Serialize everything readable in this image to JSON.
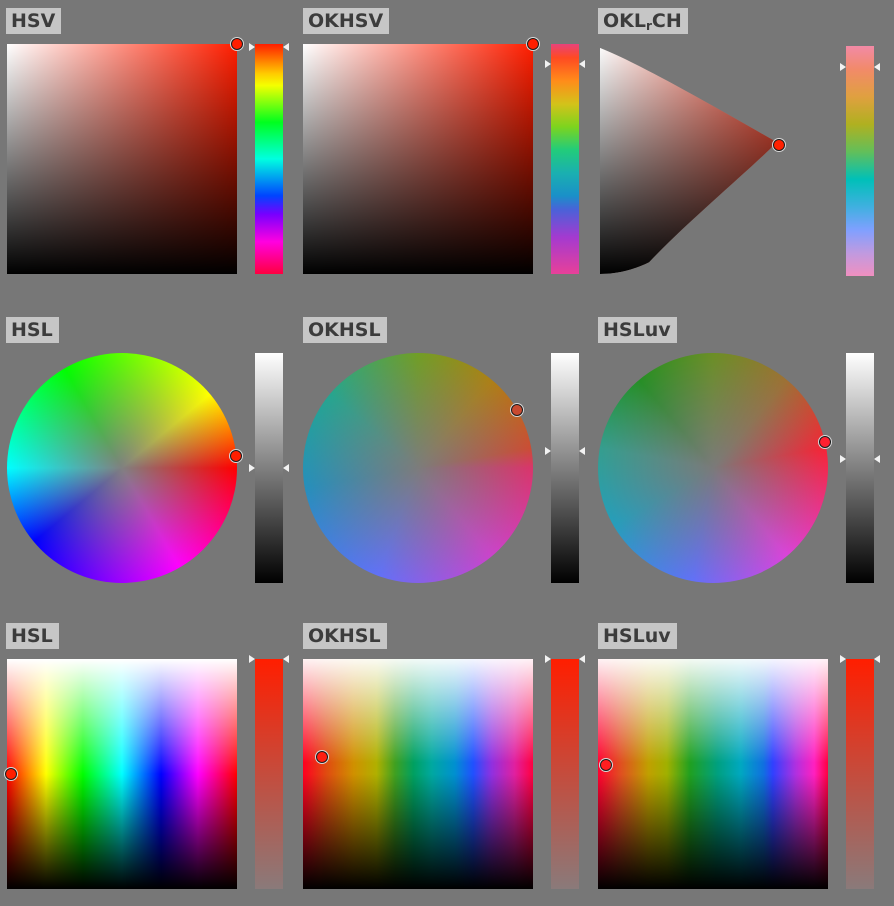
{
  "pickers": {
    "hsv": "HSV",
    "okhsv": "OKHSV",
    "oklrch_base": "OKL",
    "oklrch_sub": "r",
    "oklrch_rest": "CH",
    "hsl_wheel": "HSL",
    "okhsl_wheel": "OKHSL",
    "hsluv_wheel": "HSLuv",
    "hsl_square": "HSL",
    "okhsl_square": "OKHSL",
    "hsluv_square": "HSLuv"
  },
  "colors": {
    "background": "#777777",
    "label_background": "#c6c6c6",
    "label_text": "#3c3c3c",
    "selected_red": "#ff1e00"
  },
  "icons": {
    "handle": "circle-handle-icon",
    "slider_marker": "triangle-marker-icon"
  }
}
